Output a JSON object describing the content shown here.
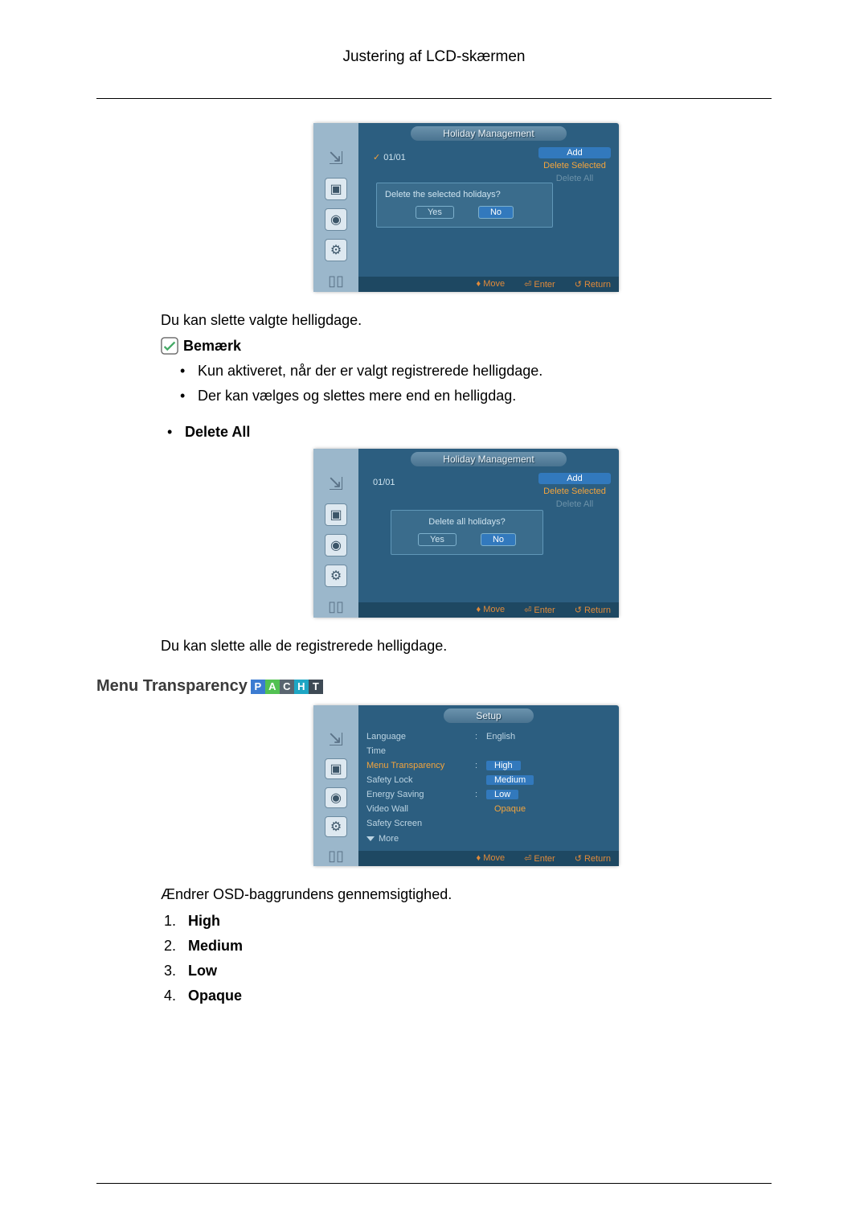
{
  "page": {
    "title": "Justering af LCD-skærmen"
  },
  "osd_common": {
    "footer_move": "Move",
    "footer_enter": "Enter",
    "footer_return": "Return"
  },
  "osd1": {
    "title": "Holiday Management",
    "date": "01/01",
    "btn_add": "Add",
    "btn_del_sel": "Delete Selected",
    "btn_del_all": "Delete All",
    "dialog_q": "Delete the selected holidays?",
    "yes": "Yes",
    "no": "No"
  },
  "sec1": {
    "para": "Du kan slette valgte helligdage.",
    "note_label": "Bemærk",
    "bullets": [
      "Kun aktiveret, når der er valgt registrerede helligdage.",
      "Der kan vælges og slettes mere end en helligdag."
    ]
  },
  "sec_deleteall": {
    "heading": "Delete All"
  },
  "osd2": {
    "title": "Holiday Management",
    "date": "01/01",
    "btn_add": "Add",
    "btn_del_sel": "Delete Selected",
    "btn_del_all": "Delete All",
    "dialog_q": "Delete all holidays?",
    "yes": "Yes",
    "no": "No"
  },
  "sec2": {
    "para": "Du kan slette alle de registrerede helligdage."
  },
  "menu_trans": {
    "heading": "Menu Transparency",
    "badge_p": "P",
    "badge_a": "A",
    "badge_c": "C",
    "badge_h": "H",
    "badge_t": "T"
  },
  "osd3": {
    "title": "Setup",
    "rows": {
      "language_l": "Language",
      "language_v": "English",
      "time_l": "Time",
      "mt_l": "Menu Transparency",
      "safety_l": "Safety Lock",
      "energy_l": "Energy Saving",
      "video_l": "Video Wall",
      "screen_l": "Safety Screen",
      "more_l": "More",
      "opt_high": "High",
      "opt_medium": "Medium",
      "opt_low": "Low",
      "opt_opaque": "Opaque"
    }
  },
  "sec3": {
    "para": "Ændrer OSD-baggrundens gennemsigtighed.",
    "list": {
      "high": "High",
      "medium": "Medium",
      "low": "Low",
      "opaque": "Opaque"
    }
  }
}
